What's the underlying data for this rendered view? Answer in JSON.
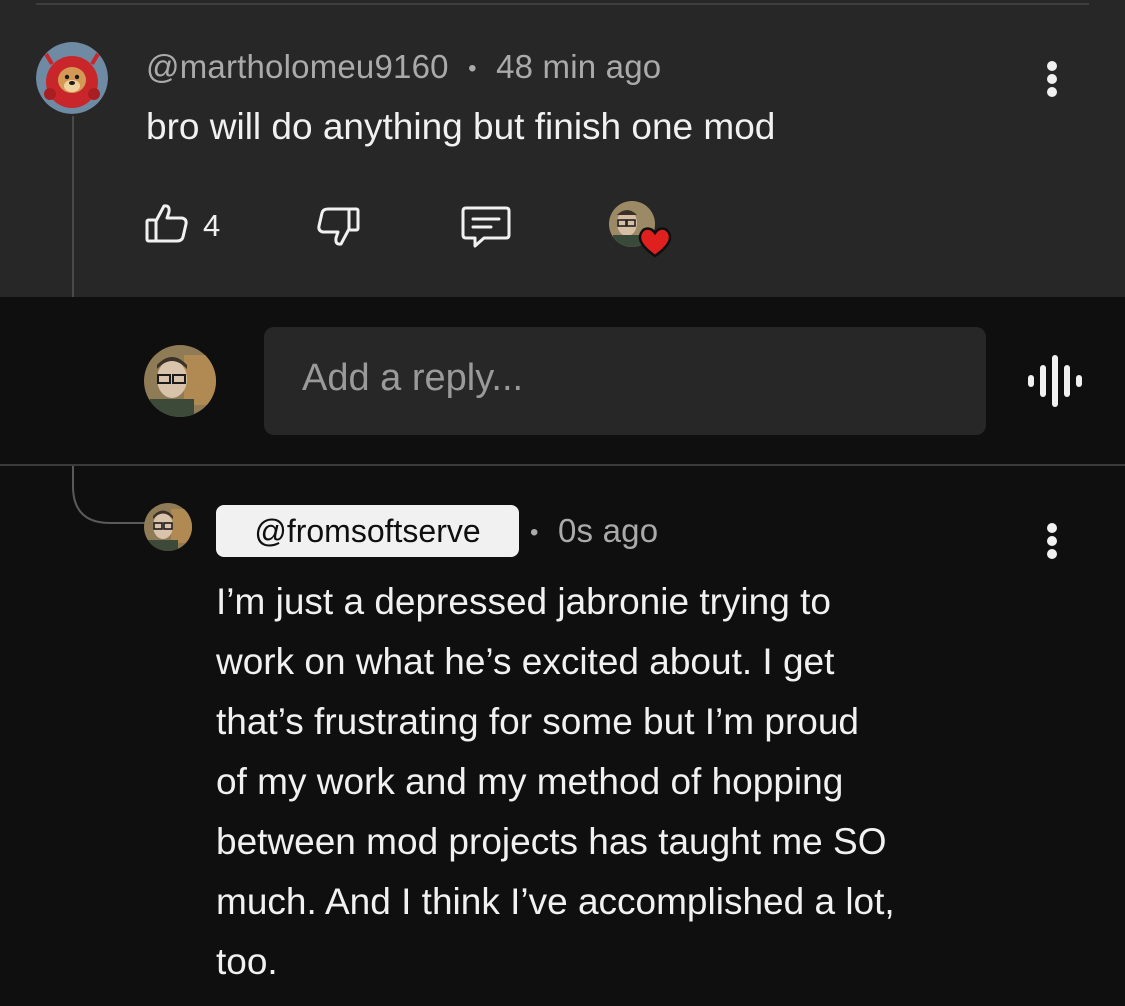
{
  "comment": {
    "author": "@martholomeu9160",
    "separator": "•",
    "time": "48 min ago",
    "text": "bro will do anything but finish one mod",
    "like_count": "4",
    "icons": [
      "thumbs-up-icon",
      "thumbs-down-icon",
      "reply-icon",
      "more-vert-icon"
    ],
    "creator_heart": true
  },
  "reply_input": {
    "placeholder": "Add a reply...",
    "voice_icon": "voice-search-icon"
  },
  "reply": {
    "author": "@fromsoftserve",
    "separator": "•",
    "time": "0s ago",
    "lines": [
      "I’m just a depressed jabronie trying to",
      "work on what he’s excited about. I get",
      "that’s frustrating for some but I’m proud",
      "of my work and my method of hopping",
      "between mod projects has taught me SO",
      "much. And I think I’ve accomplished a lot,",
      "too."
    ]
  },
  "colors": {
    "background": "#0f0f0f",
    "surface": "#272727",
    "text_primary": "#f1f1f1",
    "text_secondary": "#aaaaaa",
    "heart": "#e0201e",
    "avatar_red": "#c8262a"
  }
}
